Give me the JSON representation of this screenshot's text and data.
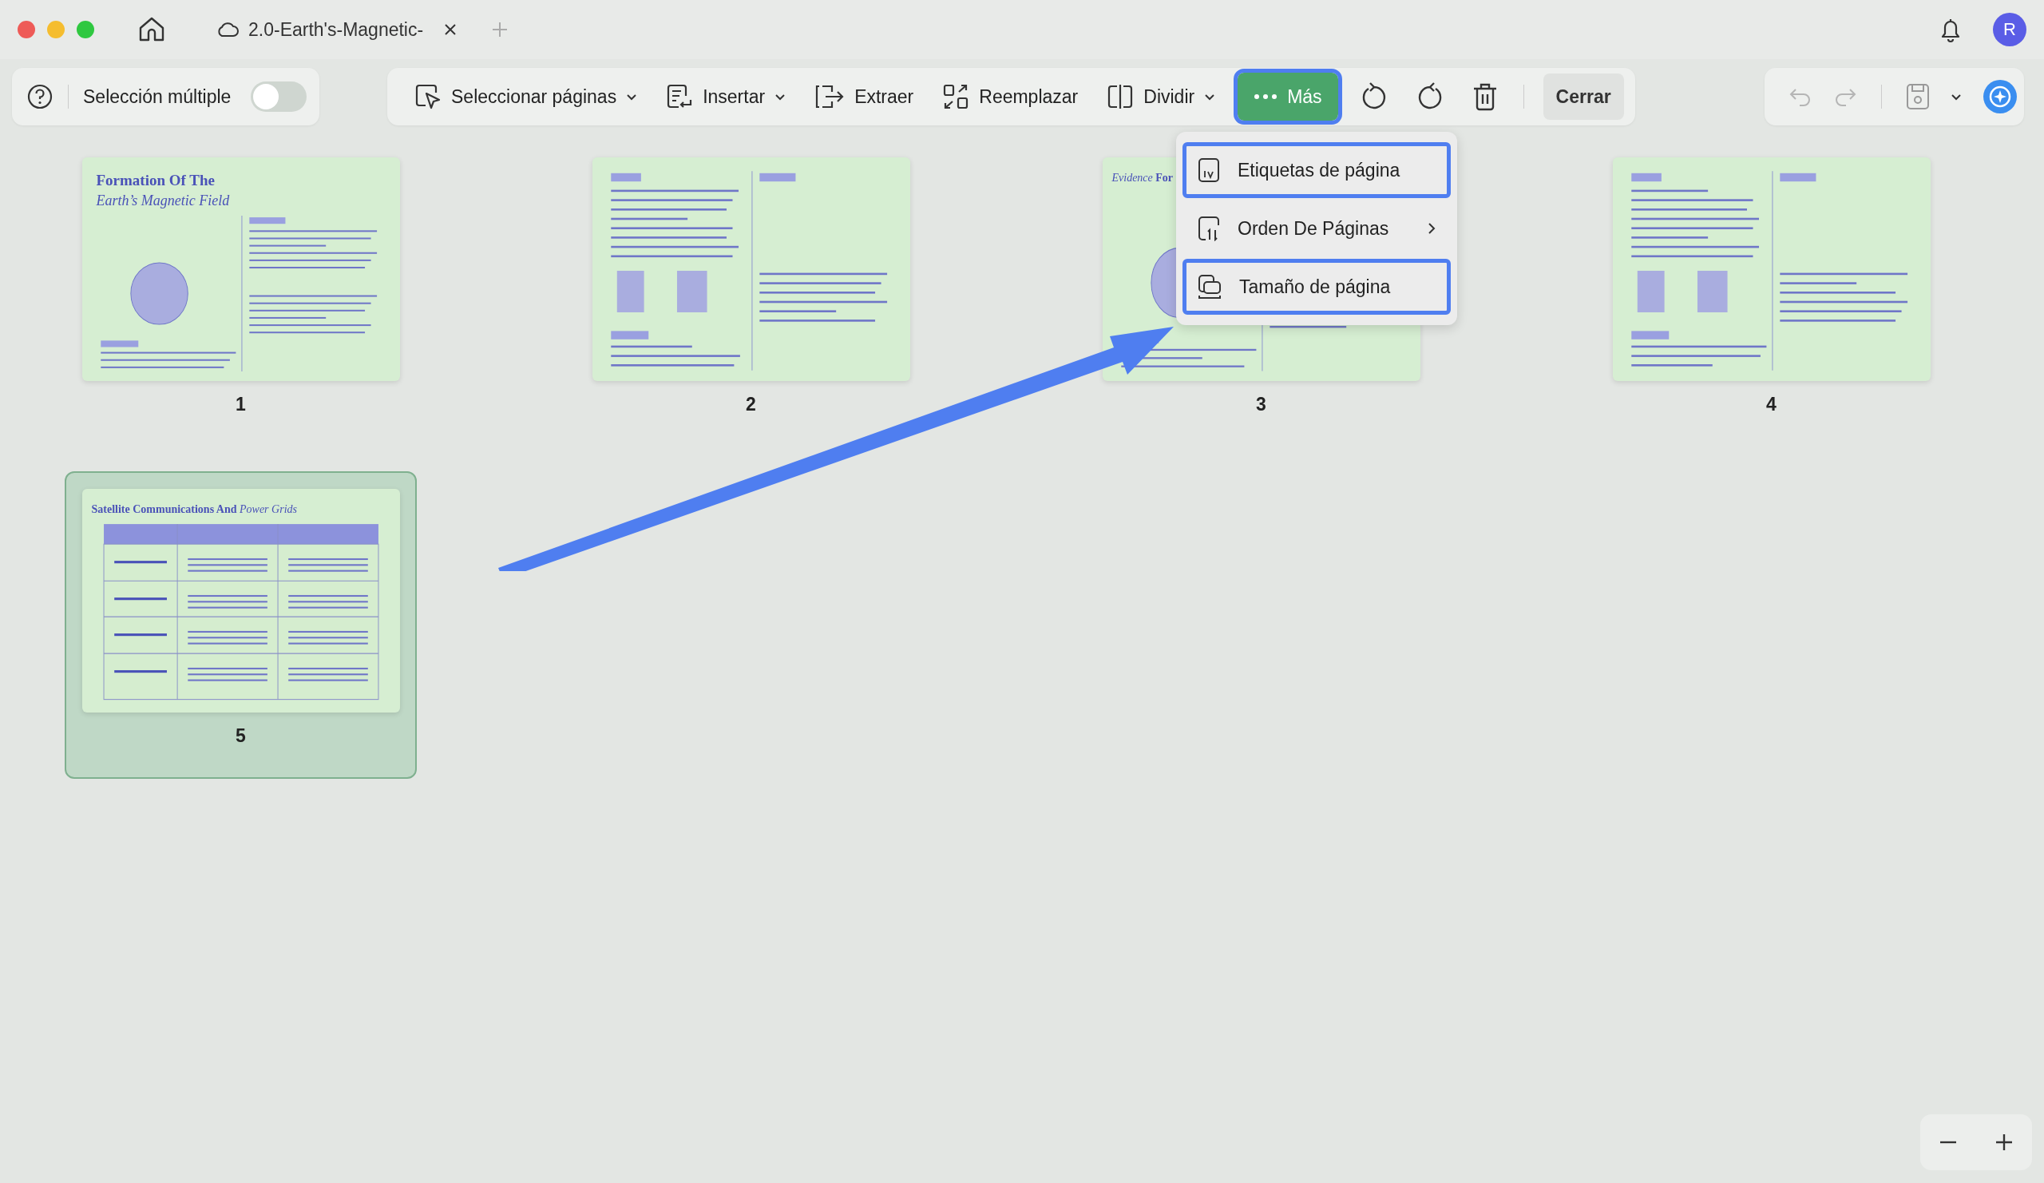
{
  "window": {
    "tab_title": "2.0-Earth's-Magnetic-",
    "avatar": "R"
  },
  "toolbar": {
    "multi_select": {
      "label": "Selección múltiple",
      "on": false
    },
    "tools": [
      {
        "label": "Seleccionar páginas",
        "dropdown": true,
        "open": false
      },
      {
        "label": "Insertar",
        "dropdown": true,
        "open": false
      },
      {
        "label": "Extraer",
        "dropdown": false,
        "open": false
      },
      {
        "label": "Reemplazar",
        "dropdown": false,
        "open": false
      },
      {
        "label": "Dividir",
        "dropdown": true,
        "open": false
      },
      {
        "label": "Más",
        "dropdown": false,
        "open": true
      }
    ],
    "close_label": "Cerrar",
    "undo_disabled": true,
    "redo_disabled": true
  },
  "menu": {
    "items": [
      {
        "label": "Etiquetas de página",
        "submenu": false,
        "highlighted": true
      },
      {
        "label": "Orden De Páginas",
        "submenu": true,
        "highlighted": false
      },
      {
        "label": "Tamaño de página",
        "submenu": false,
        "highlighted": true
      }
    ]
  },
  "pages": [
    {
      "number": "1",
      "selected": false,
      "kind": "columns",
      "title": "Formation Of The",
      "subtitle": "Earth’s Magnetic Field"
    },
    {
      "number": "2",
      "selected": false,
      "kind": "columns"
    },
    {
      "number": "3",
      "selected": false,
      "kind": "columns",
      "heading": "*Evidence* **For**"
    },
    {
      "number": "4",
      "selected": false,
      "kind": "columns"
    },
    {
      "number": "5",
      "selected": true,
      "kind": "table",
      "heading": "**Satellite Communications And** *Power Grids*"
    }
  ]
}
